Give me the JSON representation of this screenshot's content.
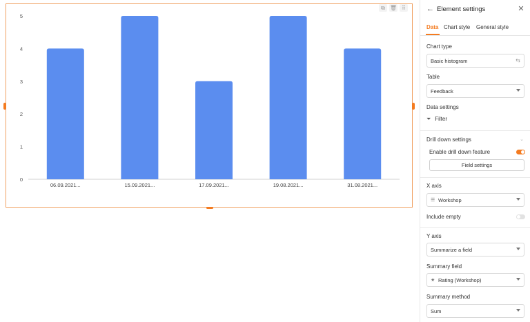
{
  "chart_data": {
    "type": "bar",
    "categories": [
      "06.09.2021...",
      "15.09.2021...",
      "17.09.2021...",
      "19.08.2021...",
      "31.08.2021..."
    ],
    "values": [
      4,
      5,
      3,
      5,
      4
    ],
    "ylim": [
      0,
      5
    ],
    "yticks": [
      "0",
      "1",
      "2",
      "3",
      "4",
      "5"
    ],
    "bar_color": "#5b8def",
    "grid": false,
    "title": "",
    "xlabel": "",
    "ylabel": ""
  },
  "chart_tools": {
    "copy_icon": "copy-icon",
    "delete_icon": "trash-icon",
    "drag_icon": "drag-icon"
  },
  "panel": {
    "title": "Element settings",
    "tabs": [
      "Data",
      "Chart style",
      "General style"
    ],
    "active_tab": "Data",
    "chart_type": {
      "label": "Chart type",
      "value": "Basic histogram"
    },
    "table": {
      "label": "Table",
      "value": "Feedback"
    },
    "data_settings": {
      "label": "Data settings",
      "filter": "Filter"
    },
    "drill_down": {
      "label": "Drill down settings",
      "enable_label": "Enable drill down feature",
      "enabled": true,
      "field_settings": "Field settings"
    },
    "x_axis": {
      "label": "X axis",
      "value": "Workshop"
    },
    "include_empty": {
      "label": "Include empty",
      "enabled": false
    },
    "y_axis": {
      "label": "Y axis",
      "value": "Summarize a field"
    },
    "summary_field": {
      "label": "Summary field",
      "value": "Rating (Workshop)"
    },
    "summary_method": {
      "label": "Summary method",
      "value": "Sum"
    }
  },
  "accent_color": "#f47b20"
}
